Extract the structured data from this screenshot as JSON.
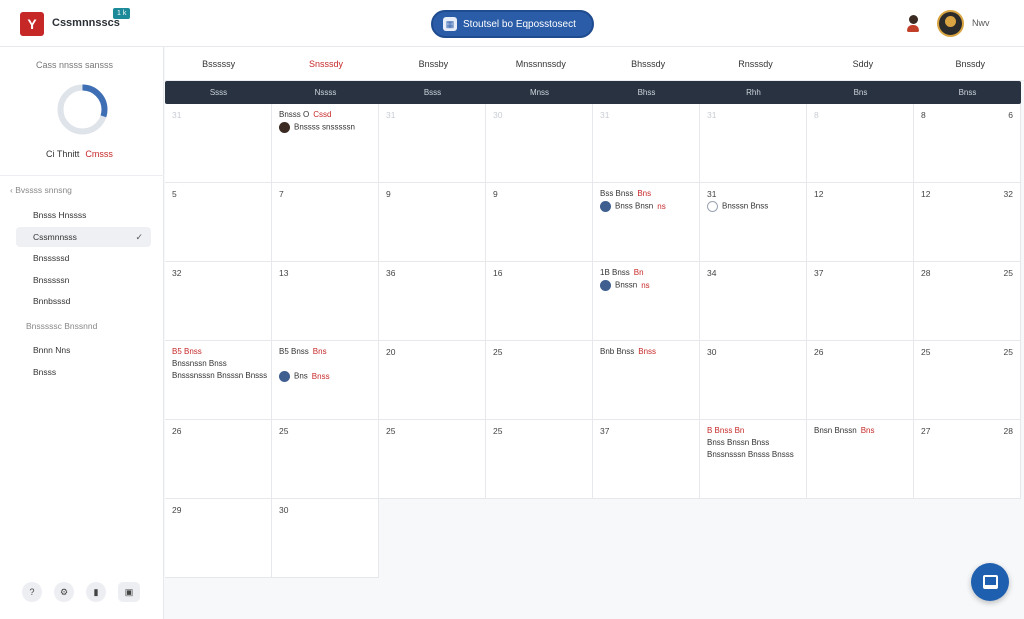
{
  "header": {
    "logo_glyph": "Y",
    "app_name": "Cssmnnsscs",
    "app_badge": "1 k",
    "center_button_label": "Stoutsel bo Eqposstosect",
    "center_button_icon": "calendar-icon",
    "user_name": "Nwv"
  },
  "sidebar": {
    "heading": "Cass nnsss sansss",
    "donut_progress": 0.3,
    "stat_text": "Ci Thnitt",
    "stat_red": "Cmsss",
    "section1": "Bvssss snnsng",
    "items1": [
      {
        "label": "Bnsss Hnssss",
        "active": false
      },
      {
        "label": "Cssmnnsss",
        "active": true
      },
      {
        "label": "Bnsssssd",
        "active": false
      },
      {
        "label": "Bnsssssn",
        "active": false
      },
      {
        "label": "Bnnbsssd",
        "active": false
      }
    ],
    "section2": "Bnsssssc Bnssnnd",
    "items2": [
      {
        "label": "Bnnn Nns"
      },
      {
        "label": "Bnsss"
      }
    ]
  },
  "calendar": {
    "day_headers": [
      {
        "label": "Bsssssy",
        "red": false
      },
      {
        "label": "Snsssdy",
        "red": true
      },
      {
        "label": "Bnssby",
        "red": false
      },
      {
        "label": "Mnssnnssdy",
        "red": false
      },
      {
        "label": "Bhsssdy",
        "red": false
      },
      {
        "label": "Rnsssdy",
        "red": false
      },
      {
        "label": "Sddy",
        "red": false
      },
      {
        "label": "Bnssdy",
        "red": false
      }
    ],
    "bar_labels": [
      "Ssss",
      "Nssss",
      "Bsss",
      "Mnss",
      "Bhss",
      "Rhh",
      "Bns",
      "Bnss"
    ],
    "weeks": [
      [
        {
          "day": "31",
          "faded": true
        },
        {
          "day": "",
          "events": [
            {
              "text": "Bnsss O",
              "red": "Cssd",
              "line": 0
            },
            {
              "dot": "dark",
              "text": "Bnssss snsssssn",
              "line": 1
            }
          ]
        },
        {
          "day": "31",
          "faded": true
        },
        {
          "day": "30",
          "faded": true
        },
        {
          "day": "31",
          "faded": true
        },
        {
          "day": "31",
          "faded": true
        },
        {
          "day": "8",
          "faded": true
        },
        {
          "day": "8",
          "faded": false,
          "right": "6"
        }
      ],
      [
        {
          "day": "5"
        },
        {
          "day": "7"
        },
        {
          "day": "9"
        },
        {
          "day": "9"
        },
        {
          "day": "",
          "events": [
            {
              "text": "Bss Bnss",
              "red": "Bns",
              "line": 0
            },
            {
              "dot": "blue",
              "text": "Bnss Bnsn",
              "red": "ns",
              "line": 1
            }
          ]
        },
        {
          "day": "31",
          "events": [
            {
              "dot": "ring",
              "text": "Bnsssn Bnss",
              "line": 1
            }
          ]
        },
        {
          "day": "12"
        },
        {
          "day": "12",
          "right": "32"
        }
      ],
      [
        {
          "day": "32"
        },
        {
          "day": "13"
        },
        {
          "day": "36"
        },
        {
          "day": "16"
        },
        {
          "day": "",
          "events": [
            {
              "text": "1B Bnss",
              "red": "Bn",
              "line": 0
            },
            {
              "dot": "blue",
              "text": "Bnssn",
              "red": "ns",
              "line": 1
            }
          ]
        },
        {
          "day": "34"
        },
        {
          "day": "37"
        },
        {
          "day": "28",
          "right": "25"
        }
      ],
      [
        {
          "day": "",
          "events": [
            {
              "red_only": "B5 Bnss",
              "line": 0
            },
            {
              "text": "Bnssnssn Bnss",
              "line": 1
            },
            {
              "text": "Bnsssnsssn Bnsssn Bnsss",
              "line": 2
            }
          ]
        },
        {
          "day": "",
          "events": [
            {
              "text": "B5 Bnss",
              "red": "Bns",
              "line": 0
            },
            {
              "dot": "blue",
              "text": "Bns",
              "red": "Bnss",
              "line": 2
            }
          ]
        },
        {
          "day": "20"
        },
        {
          "day": "25"
        },
        {
          "day": "",
          "events": [
            {
              "text": "Bnb Bnss",
              "red": "Bnss",
              "line": 0
            }
          ]
        },
        {
          "day": "30"
        },
        {
          "day": "26"
        },
        {
          "day": "25",
          "right": "25"
        }
      ],
      [
        {
          "day": "26"
        },
        {
          "day": "25"
        },
        {
          "day": "25"
        },
        {
          "day": "25"
        },
        {
          "day": "37"
        },
        {
          "day": "",
          "events": [
            {
              "red_only": "B Bnss Bn",
              "line": 0
            },
            {
              "text": "Bnss Bnssn Bnss",
              "line": 1
            },
            {
              "text": "Bnssnsssn Bnsss Bnsss",
              "line": 2
            }
          ]
        },
        {
          "day": "",
          "events": [
            {
              "text": "Bnsn Bnssn",
              "red": "Bns",
              "line": 0
            }
          ]
        },
        {
          "day": "27",
          "right": "28"
        }
      ],
      [
        {
          "day": "29"
        },
        {
          "day": "30"
        }
      ]
    ]
  },
  "fab_icon": "chat-icon"
}
